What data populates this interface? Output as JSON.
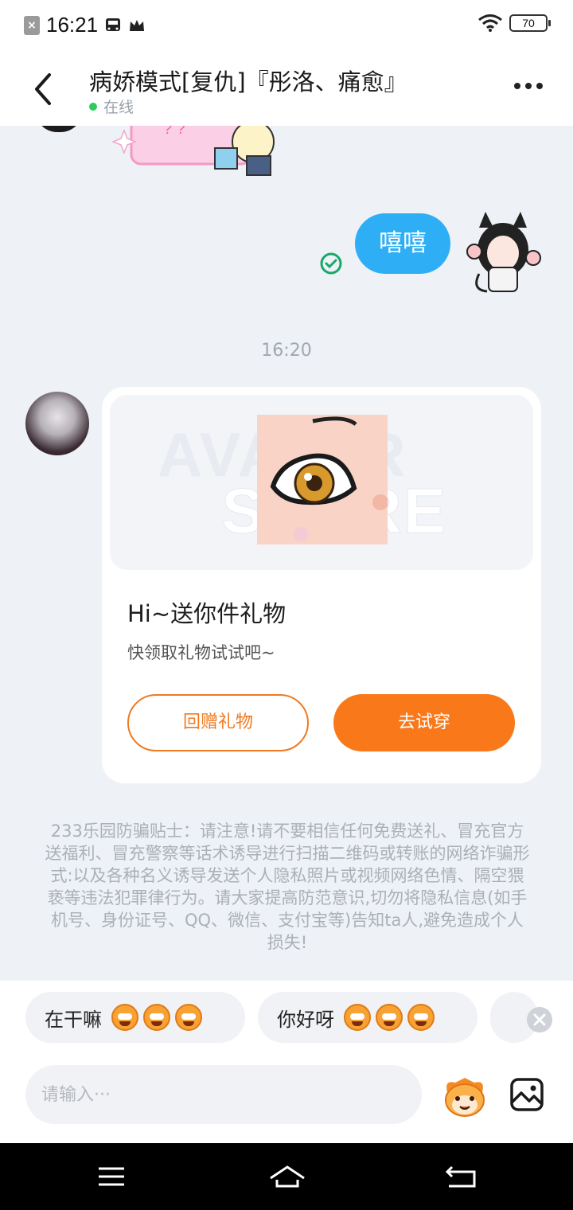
{
  "status_bar": {
    "time": "16:21",
    "battery": "70"
  },
  "header": {
    "title": "病娇模式[复仇]『彤洛、痛愈』",
    "status": "在线"
  },
  "messages": {
    "mine_text": "嘻嘻",
    "timestamp": "16:20"
  },
  "gift_card": {
    "watermark_line1": "AVATAR",
    "watermark_line2": "STORE",
    "title": "Hi~送你件礼物",
    "subtitle": "快领取礼物试试吧~",
    "return_button": "回赠礼物",
    "try_button": "去试穿"
  },
  "warning": "233乐园防骗贴士：请注意!请不要相信任何免费送礼、冒充官方送福利、冒充警察等话术诱导进行扫描二维码或转账的网络诈骗形式:以及各种名义诱导发送个人隐私照片或视频网络色情、隔空猥亵等违法犯罪律行为。请大家提高防范意识,切勿将隐私信息(如手机号、身份证号、QQ、微信、支付宝等)告知ta人,避免造成个人损失!",
  "quick_replies": [
    {
      "text": "在干嘛"
    },
    {
      "text": "你好呀"
    }
  ],
  "input": {
    "placeholder": "请输入···"
  },
  "colors": {
    "accent_orange": "#f8781a",
    "bubble_blue": "#2eaef4",
    "online_green": "#2ecc5b"
  }
}
